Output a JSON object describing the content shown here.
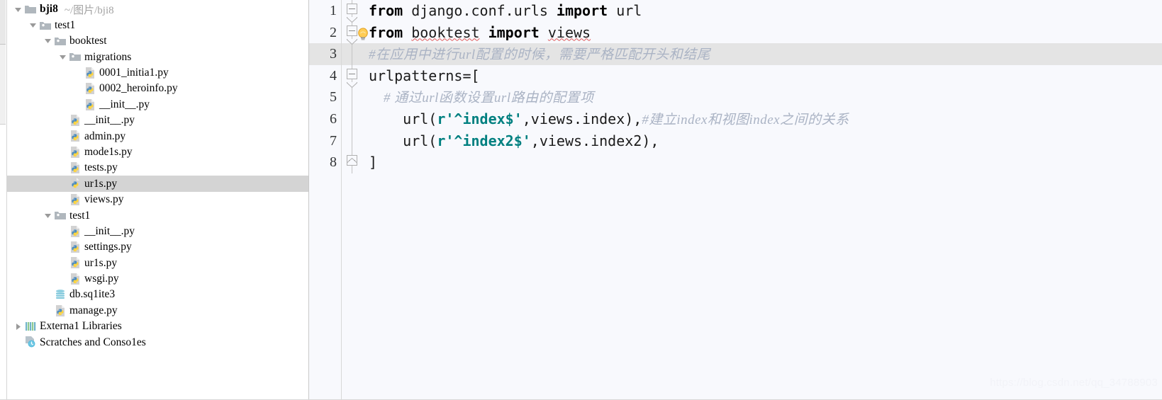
{
  "window": {
    "watermark": "https://blog.csdn.net/qq_34788903"
  },
  "project_panel": {
    "name": "project-tree",
    "tree": [
      {
        "label": "bji8",
        "path": "~/图片/bji8",
        "icon": "folder-icon",
        "indent": 0,
        "twisty": "down",
        "bold": true,
        "selected": false
      },
      {
        "label": "test1",
        "path": "",
        "icon": "module-folder-icon",
        "indent": 1,
        "twisty": "down",
        "bold": false,
        "selected": false
      },
      {
        "label": "booktest",
        "path": "",
        "icon": "module-folder-icon",
        "indent": 2,
        "twisty": "down",
        "bold": false,
        "selected": false
      },
      {
        "label": "migrations",
        "path": "",
        "icon": "module-folder-icon",
        "indent": 3,
        "twisty": "down",
        "bold": false,
        "selected": false
      },
      {
        "label": "0001_initia1.py",
        "path": "",
        "icon": "python-file-icon",
        "indent": 4,
        "twisty": "none",
        "bold": false,
        "selected": false
      },
      {
        "label": "0002_heroinfo.py",
        "path": "",
        "icon": "python-file-icon",
        "indent": 4,
        "twisty": "none",
        "bold": false,
        "selected": false
      },
      {
        "label": "__init__.py",
        "path": "",
        "icon": "python-file-icon",
        "indent": 4,
        "twisty": "none",
        "bold": false,
        "selected": false
      },
      {
        "label": "__init__.py",
        "path": "",
        "icon": "python-file-icon",
        "indent": 3,
        "twisty": "none",
        "bold": false,
        "selected": false
      },
      {
        "label": "admin.py",
        "path": "",
        "icon": "python-file-icon",
        "indent": 3,
        "twisty": "none",
        "bold": false,
        "selected": false
      },
      {
        "label": "mode1s.py",
        "path": "",
        "icon": "python-file-icon",
        "indent": 3,
        "twisty": "none",
        "bold": false,
        "selected": false
      },
      {
        "label": "tests.py",
        "path": "",
        "icon": "python-file-icon",
        "indent": 3,
        "twisty": "none",
        "bold": false,
        "selected": false
      },
      {
        "label": "ur1s.py",
        "path": "",
        "icon": "python-file-icon",
        "indent": 3,
        "twisty": "none",
        "bold": false,
        "selected": true
      },
      {
        "label": "views.py",
        "path": "",
        "icon": "python-file-icon",
        "indent": 3,
        "twisty": "none",
        "bold": false,
        "selected": false
      },
      {
        "label": "test1",
        "path": "",
        "icon": "module-folder-icon",
        "indent": 2,
        "twisty": "down",
        "bold": false,
        "selected": false
      },
      {
        "label": "__init__.py",
        "path": "",
        "icon": "python-file-icon",
        "indent": 3,
        "twisty": "none",
        "bold": false,
        "selected": false
      },
      {
        "label": "settings.py",
        "path": "",
        "icon": "python-file-icon",
        "indent": 3,
        "twisty": "none",
        "bold": false,
        "selected": false
      },
      {
        "label": "ur1s.py",
        "path": "",
        "icon": "python-file-icon",
        "indent": 3,
        "twisty": "none",
        "bold": false,
        "selected": false
      },
      {
        "label": "wsgi.py",
        "path": "",
        "icon": "python-file-icon",
        "indent": 3,
        "twisty": "none",
        "bold": false,
        "selected": false
      },
      {
        "label": "db.sq1ite3",
        "path": "",
        "icon": "database-icon",
        "indent": 2,
        "twisty": "none",
        "bold": false,
        "selected": false
      },
      {
        "label": "manage.py",
        "path": "",
        "icon": "python-file-icon",
        "indent": 2,
        "twisty": "none",
        "bold": false,
        "selected": false
      },
      {
        "label": "Externa1 Libraries",
        "path": "",
        "icon": "libraries-icon",
        "indent": 0,
        "twisty": "right",
        "bold": false,
        "selected": false
      },
      {
        "label": "Scratches and Conso1es",
        "path": "",
        "icon": "scratches-icon",
        "indent": 0,
        "twisty": "none",
        "bold": false,
        "selected": false
      }
    ]
  },
  "editor": {
    "name": "code-editor",
    "language": "python",
    "current_line": 3,
    "line_numbers": [
      "1",
      "2",
      "3",
      "4",
      "5",
      "6",
      "7",
      "8"
    ],
    "fold_markers": [
      {
        "line": 1,
        "type": "down"
      },
      {
        "line": 2,
        "type": "down"
      },
      {
        "line": 4,
        "type": "down"
      },
      {
        "line": 8,
        "type": "up"
      }
    ],
    "intention_bulb": {
      "line": 2,
      "icon": "lightbulb-icon"
    },
    "lines": [
      {
        "n": 1,
        "tokens": [
          {
            "t": "from ",
            "cls": "kw"
          },
          {
            "t": "django.conf.urls",
            "cls": "plain"
          },
          {
            "t": " import ",
            "cls": "kw"
          },
          {
            "t": "url",
            "cls": "plain"
          }
        ]
      },
      {
        "n": 2,
        "tokens": [
          {
            "t": "from ",
            "cls": "kw"
          },
          {
            "t": "booktest",
            "cls": "plain wavy-err"
          },
          {
            "t": " import ",
            "cls": "kw"
          },
          {
            "t": "views",
            "cls": "plain wavy-err"
          }
        ]
      },
      {
        "n": 3,
        "tokens": [
          {
            "t": "#在应用中进行url配置的时候，需要严格匹配开头和结尾",
            "cls": "comment-cn"
          }
        ]
      },
      {
        "n": 4,
        "tokens": [
          {
            "t": "urlpatterns=[",
            "cls": "plain"
          }
        ]
      },
      {
        "n": 5,
        "tokens": [
          {
            "t": "    # 通过url函数设置url路由的配置项",
            "cls": "comment-cn"
          }
        ]
      },
      {
        "n": 6,
        "tokens": [
          {
            "t": "    url(",
            "cls": "plain"
          },
          {
            "t": "r'^index$'",
            "cls": "str"
          },
          {
            "t": ",views.index),",
            "cls": "plain"
          },
          {
            "t": "#建立index和视图index之间的关系",
            "cls": "comment-cn"
          }
        ]
      },
      {
        "n": 7,
        "tokens": [
          {
            "t": "    url(",
            "cls": "plain"
          },
          {
            "t": "r'^index2$'",
            "cls": "str"
          },
          {
            "t": ",views.index2),",
            "cls": "plain"
          }
        ]
      },
      {
        "n": 8,
        "tokens": [
          {
            "t": "]",
            "cls": "plain"
          }
        ]
      }
    ]
  },
  "colors": {
    "editor_background": "#f8f9fd",
    "current_line_highlight": "#e4e4e4",
    "tree_selection": "#d4d4d4",
    "string_literal": "#008080",
    "comment": "#aab3c4",
    "keyword": "#000000"
  }
}
